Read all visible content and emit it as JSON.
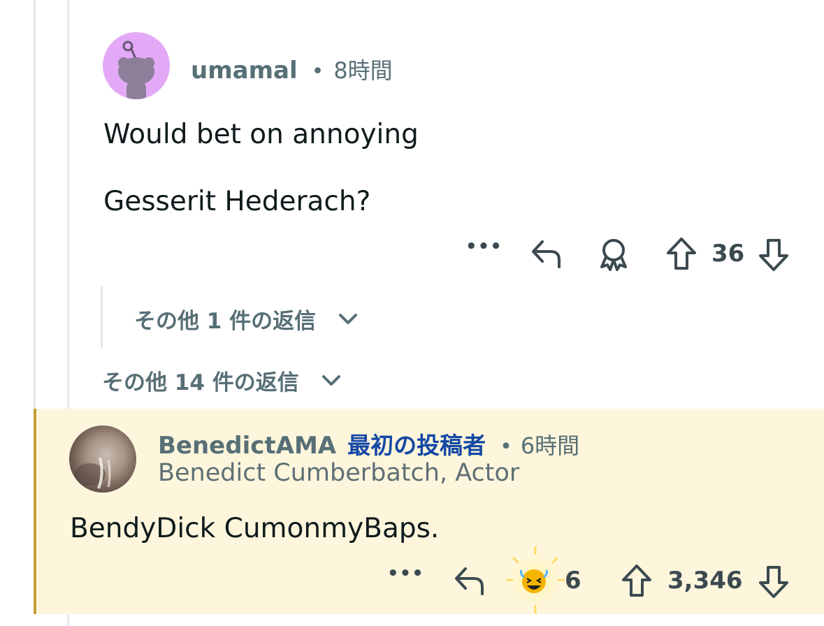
{
  "comments": [
    {
      "username": "umamal",
      "time": "8時間",
      "paragraphs": [
        "Would bet on annoying",
        "Gesserit Hederach?"
      ],
      "actions": {
        "more": "•••",
        "upvotes": "36"
      },
      "nested_more_replies": "その他 1 件の返信",
      "avatar_icon": "snoo-avatar-icon"
    },
    {
      "username": "BenedictAMA",
      "op_badge": "最初の投稿者",
      "time": "6時間",
      "flair": "Benedict Cumberbatch, Actor",
      "paragraphs": [
        "BendyDick CumonmyBaps."
      ],
      "actions": {
        "more": "•••",
        "award_count": "6",
        "upvotes": "3,346"
      },
      "award_icon": "laughing-crying-award-icon"
    }
  ],
  "thread_more_replies": "その他 14 件の返信",
  "separator": "•",
  "colors": {
    "op_background": "#fdf6dc",
    "op_border": "#c2a13a",
    "op_badge": "#1448a4",
    "meta_text": "#576f76",
    "snoo_background": "#e3a9f7"
  }
}
